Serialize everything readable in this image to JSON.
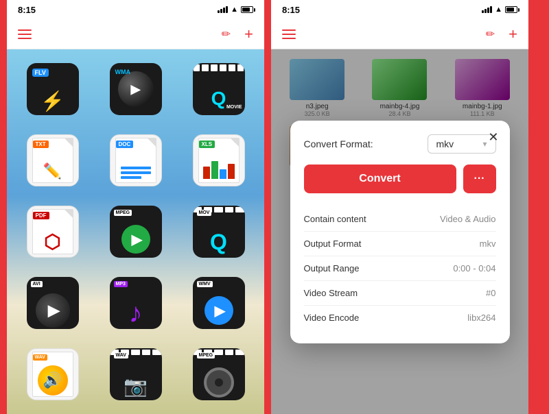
{
  "left_phone": {
    "status_time": "8:15",
    "toolbar": {
      "menu_label": "☰",
      "edit_label": "✏",
      "add_label": "+"
    },
    "icons": [
      {
        "id": "flv",
        "badge": "FLV",
        "type": "flv"
      },
      {
        "id": "wma",
        "badge": "WMA",
        "type": "wma"
      },
      {
        "id": "movie",
        "badge": "MOVIE",
        "type": "movie"
      },
      {
        "id": "txt",
        "badge": "TXT",
        "type": "txt"
      },
      {
        "id": "doc",
        "badge": "DOC",
        "type": "doc"
      },
      {
        "id": "xls",
        "badge": "XLS",
        "type": "xls"
      },
      {
        "id": "pdf",
        "badge": "PDF",
        "type": "pdf"
      },
      {
        "id": "mpeg",
        "badge": "MPEG",
        "type": "mpeg"
      },
      {
        "id": "mov",
        "badge": "MOV",
        "type": "mov"
      },
      {
        "id": "avi",
        "badge": "AVI",
        "type": "avi"
      },
      {
        "id": "mp3",
        "badge": "MP3",
        "type": "mp3"
      },
      {
        "id": "wmv",
        "badge": "WMV",
        "type": "wmv"
      },
      {
        "id": "wav1",
        "badge": "WAV",
        "type": "wav_gold"
      },
      {
        "id": "wav2",
        "badge": "WAV",
        "type": "wav_film"
      },
      {
        "id": "mpeg2",
        "badge": "MPEG",
        "type": "mpeg2"
      }
    ]
  },
  "right_phone": {
    "status_time": "8:15",
    "toolbar": {
      "menu_label": "☰",
      "edit_label": "✏",
      "add_label": "+"
    },
    "files": [
      {
        "name": "n3.jpeg",
        "size": "325.0 KB",
        "thumb": "gradient1"
      },
      {
        "name": "mainbg-4.jpg",
        "size": "28.4 KB",
        "thumb": "gradient2"
      },
      {
        "name": "mainbg-1.jpg",
        "size": "111.1 KB",
        "thumb": "gradient3"
      },
      {
        "name": "",
        "size": "",
        "thumb": "face1"
      },
      {
        "name": "",
        "size": "",
        "thumb": "face2"
      },
      {
        "name": "",
        "size": "",
        "thumb": "face3"
      }
    ],
    "modal": {
      "close_label": "✕",
      "format_label": "Convert Format:",
      "format_value": "mkv",
      "convert_btn": "Convert",
      "more_btn": "···",
      "info_rows": [
        {
          "key": "Contain content",
          "value": "Video & Audio"
        },
        {
          "key": "Output Format",
          "value": "mkv"
        },
        {
          "key": "Output Range",
          "value": "0:00 - 0:04"
        },
        {
          "key": "Video Stream",
          "value": "#0"
        },
        {
          "key": "Video Encode",
          "value": "libx264"
        }
      ]
    }
  }
}
